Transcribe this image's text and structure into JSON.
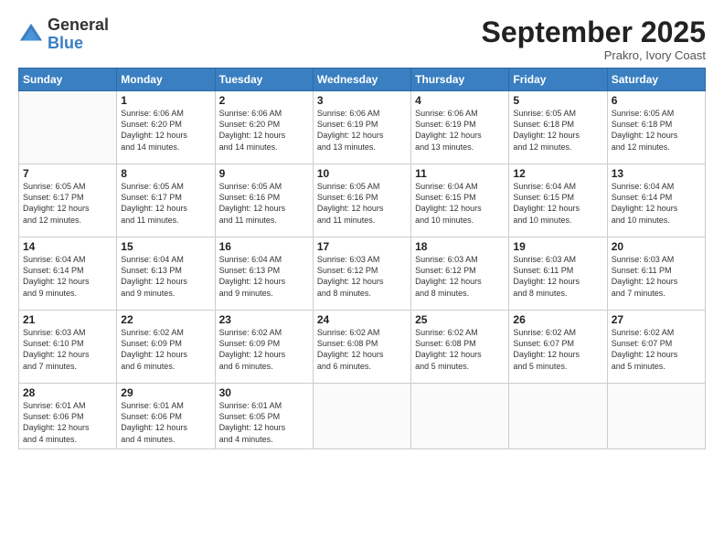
{
  "header": {
    "logo_general": "General",
    "logo_blue": "Blue",
    "month": "September 2025",
    "location": "Prakro, Ivory Coast"
  },
  "days_of_week": [
    "Sunday",
    "Monday",
    "Tuesday",
    "Wednesday",
    "Thursday",
    "Friday",
    "Saturday"
  ],
  "weeks": [
    [
      {
        "day": "",
        "info": ""
      },
      {
        "day": "1",
        "info": "Sunrise: 6:06 AM\nSunset: 6:20 PM\nDaylight: 12 hours\nand 14 minutes."
      },
      {
        "day": "2",
        "info": "Sunrise: 6:06 AM\nSunset: 6:20 PM\nDaylight: 12 hours\nand 14 minutes."
      },
      {
        "day": "3",
        "info": "Sunrise: 6:06 AM\nSunset: 6:19 PM\nDaylight: 12 hours\nand 13 minutes."
      },
      {
        "day": "4",
        "info": "Sunrise: 6:06 AM\nSunset: 6:19 PM\nDaylight: 12 hours\nand 13 minutes."
      },
      {
        "day": "5",
        "info": "Sunrise: 6:05 AM\nSunset: 6:18 PM\nDaylight: 12 hours\nand 12 minutes."
      },
      {
        "day": "6",
        "info": "Sunrise: 6:05 AM\nSunset: 6:18 PM\nDaylight: 12 hours\nand 12 minutes."
      }
    ],
    [
      {
        "day": "7",
        "info": "Sunrise: 6:05 AM\nSunset: 6:17 PM\nDaylight: 12 hours\nand 12 minutes."
      },
      {
        "day": "8",
        "info": "Sunrise: 6:05 AM\nSunset: 6:17 PM\nDaylight: 12 hours\nand 11 minutes."
      },
      {
        "day": "9",
        "info": "Sunrise: 6:05 AM\nSunset: 6:16 PM\nDaylight: 12 hours\nand 11 minutes."
      },
      {
        "day": "10",
        "info": "Sunrise: 6:05 AM\nSunset: 6:16 PM\nDaylight: 12 hours\nand 11 minutes."
      },
      {
        "day": "11",
        "info": "Sunrise: 6:04 AM\nSunset: 6:15 PM\nDaylight: 12 hours\nand 10 minutes."
      },
      {
        "day": "12",
        "info": "Sunrise: 6:04 AM\nSunset: 6:15 PM\nDaylight: 12 hours\nand 10 minutes."
      },
      {
        "day": "13",
        "info": "Sunrise: 6:04 AM\nSunset: 6:14 PM\nDaylight: 12 hours\nand 10 minutes."
      }
    ],
    [
      {
        "day": "14",
        "info": "Sunrise: 6:04 AM\nSunset: 6:14 PM\nDaylight: 12 hours\nand 9 minutes."
      },
      {
        "day": "15",
        "info": "Sunrise: 6:04 AM\nSunset: 6:13 PM\nDaylight: 12 hours\nand 9 minutes."
      },
      {
        "day": "16",
        "info": "Sunrise: 6:04 AM\nSunset: 6:13 PM\nDaylight: 12 hours\nand 9 minutes."
      },
      {
        "day": "17",
        "info": "Sunrise: 6:03 AM\nSunset: 6:12 PM\nDaylight: 12 hours\nand 8 minutes."
      },
      {
        "day": "18",
        "info": "Sunrise: 6:03 AM\nSunset: 6:12 PM\nDaylight: 12 hours\nand 8 minutes."
      },
      {
        "day": "19",
        "info": "Sunrise: 6:03 AM\nSunset: 6:11 PM\nDaylight: 12 hours\nand 8 minutes."
      },
      {
        "day": "20",
        "info": "Sunrise: 6:03 AM\nSunset: 6:11 PM\nDaylight: 12 hours\nand 7 minutes."
      }
    ],
    [
      {
        "day": "21",
        "info": "Sunrise: 6:03 AM\nSunset: 6:10 PM\nDaylight: 12 hours\nand 7 minutes."
      },
      {
        "day": "22",
        "info": "Sunrise: 6:02 AM\nSunset: 6:09 PM\nDaylight: 12 hours\nand 6 minutes."
      },
      {
        "day": "23",
        "info": "Sunrise: 6:02 AM\nSunset: 6:09 PM\nDaylight: 12 hours\nand 6 minutes."
      },
      {
        "day": "24",
        "info": "Sunrise: 6:02 AM\nSunset: 6:08 PM\nDaylight: 12 hours\nand 6 minutes."
      },
      {
        "day": "25",
        "info": "Sunrise: 6:02 AM\nSunset: 6:08 PM\nDaylight: 12 hours\nand 5 minutes."
      },
      {
        "day": "26",
        "info": "Sunrise: 6:02 AM\nSunset: 6:07 PM\nDaylight: 12 hours\nand 5 minutes."
      },
      {
        "day": "27",
        "info": "Sunrise: 6:02 AM\nSunset: 6:07 PM\nDaylight: 12 hours\nand 5 minutes."
      }
    ],
    [
      {
        "day": "28",
        "info": "Sunrise: 6:01 AM\nSunset: 6:06 PM\nDaylight: 12 hours\nand 4 minutes."
      },
      {
        "day": "29",
        "info": "Sunrise: 6:01 AM\nSunset: 6:06 PM\nDaylight: 12 hours\nand 4 minutes."
      },
      {
        "day": "30",
        "info": "Sunrise: 6:01 AM\nSunset: 6:05 PM\nDaylight: 12 hours\nand 4 minutes."
      },
      {
        "day": "",
        "info": ""
      },
      {
        "day": "",
        "info": ""
      },
      {
        "day": "",
        "info": ""
      },
      {
        "day": "",
        "info": ""
      }
    ]
  ]
}
